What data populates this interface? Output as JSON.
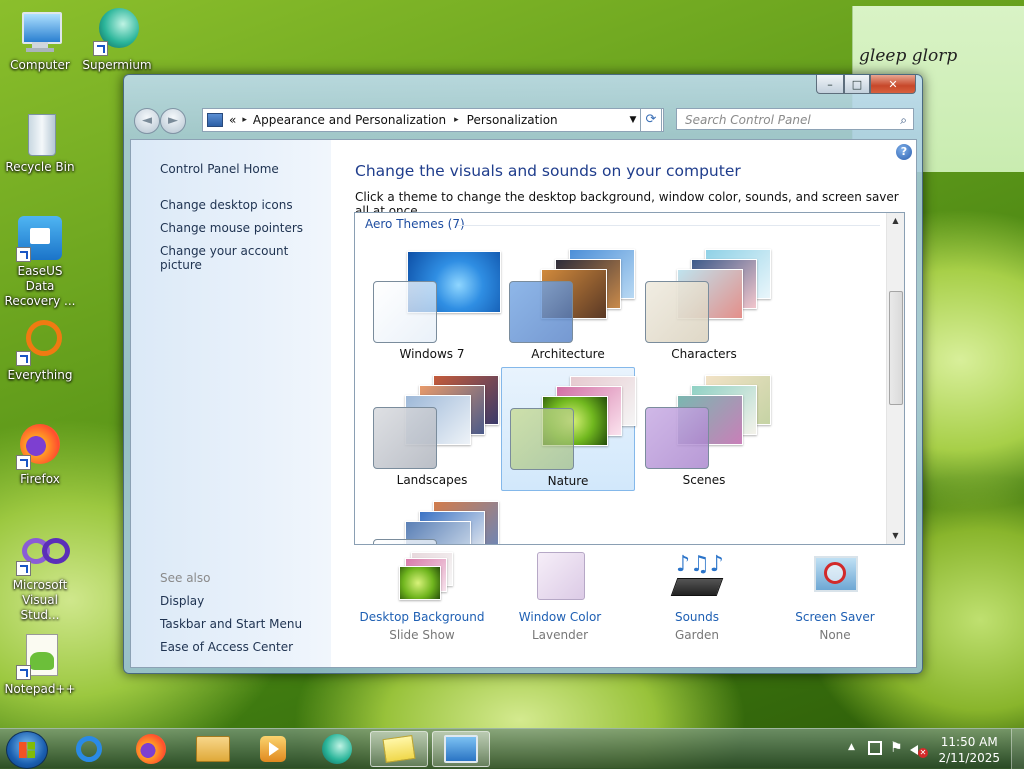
{
  "desktop": {
    "icons": [
      {
        "label": "Computer",
        "icon": "computer-icon"
      },
      {
        "label": "Supermium",
        "icon": "supermium-icon"
      },
      {
        "label": "Recycle Bin",
        "icon": "recycle-bin-icon"
      },
      {
        "label": "EaseUS Data Recovery ...",
        "icon": "easeus-icon"
      },
      {
        "label": "Everything",
        "icon": "everything-icon"
      },
      {
        "label": "Firefox",
        "icon": "firefox-icon"
      },
      {
        "label": "Microsoft Visual Stud...",
        "icon": "visual-studio-icon"
      },
      {
        "label": "Notepad++",
        "icon": "notepadpp-icon"
      }
    ],
    "sticky_note": {
      "text": "gleep glorp"
    }
  },
  "window": {
    "caption_buttons": {
      "minimize": "–",
      "maximize": "□",
      "close": "✕"
    },
    "nav": {
      "back": "◄",
      "forward": "►"
    },
    "address": {
      "overflow": "«",
      "crumbs": [
        "Appearance and Personalization",
        "Personalization"
      ],
      "separator": "▸",
      "dropdown": "▼",
      "refresh": "⟳"
    },
    "search": {
      "placeholder": "Search Control Panel",
      "icon": "⌕"
    },
    "left_pane": {
      "home": "Control Panel Home",
      "links": [
        "Change desktop icons",
        "Change mouse pointers",
        "Change your account picture"
      ],
      "see_also_label": "See also",
      "see_also": [
        "Display",
        "Taskbar and Start Menu",
        "Ease of Access Center"
      ]
    },
    "main": {
      "title": "Change the visuals and sounds on your computer",
      "subtitle": "Click a theme to change the desktop background, window color, sounds, and screen saver all at once.",
      "help": "?",
      "group_header": "Aero Themes (7)",
      "themes": [
        {
          "name": "Windows 7",
          "selected": false
        },
        {
          "name": "Architecture",
          "selected": false
        },
        {
          "name": "Characters",
          "selected": false
        },
        {
          "name": "Landscapes",
          "selected": false
        },
        {
          "name": "Nature",
          "selected": true
        },
        {
          "name": "Scenes",
          "selected": false
        }
      ],
      "bottom_items": [
        {
          "title": "Desktop Background",
          "value": "Slide Show"
        },
        {
          "title": "Window Color",
          "value": "Lavender"
        },
        {
          "title": "Sounds",
          "value": "Garden"
        },
        {
          "title": "Screen Saver",
          "value": "None"
        }
      ]
    }
  },
  "taskbar": {
    "pinned": [
      "internet-explorer-icon",
      "firefox-icon",
      "file-explorer-icon",
      "media-player-icon",
      "supermium-icon",
      "sticky-notes-icon",
      "control-panel-icon"
    ],
    "clock": {
      "time": "11:50 AM",
      "date": "2/11/2025"
    }
  }
}
